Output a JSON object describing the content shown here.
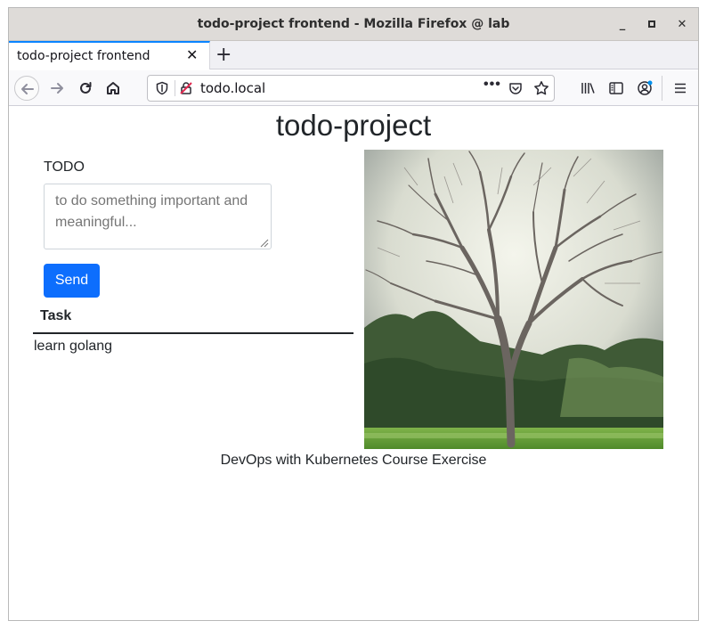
{
  "window": {
    "title": "todo-project frontend - Mozilla Firefox @ lab"
  },
  "tabs": [
    {
      "label": "todo-project frontend",
      "active": true
    }
  ],
  "navbar": {
    "url": "todo.local"
  },
  "page": {
    "title": "todo-project",
    "form": {
      "label": "TODO",
      "placeholder": "to do something important and meaningful...",
      "send_label": "Send"
    },
    "table": {
      "header": "Task",
      "rows": [
        "learn golang"
      ]
    },
    "footer": "DevOps with Kubernetes Course Exercise"
  },
  "colors": {
    "accent": "#0d6efd",
    "tab_highlight": "#0a84ff"
  },
  "icons": [
    "back-icon",
    "forward-icon",
    "reload-icon",
    "home-icon",
    "shield-icon",
    "insecure-lock-icon",
    "more-icon",
    "pocket-icon",
    "bookmark-star-icon",
    "library-icon",
    "sidebar-icon",
    "account-icon",
    "menu-icon"
  ]
}
